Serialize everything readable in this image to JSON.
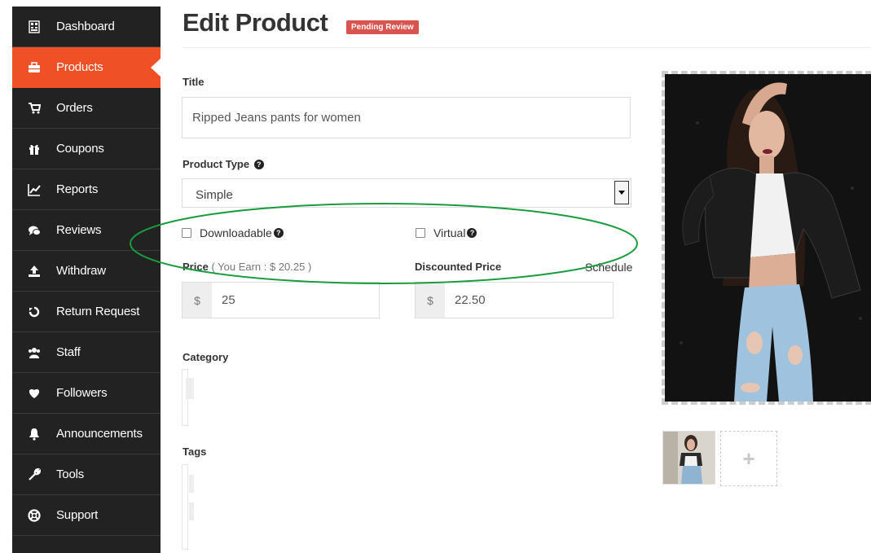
{
  "sidebar": {
    "items": [
      {
        "label": "Dashboard",
        "icon": "dashboard-icon"
      },
      {
        "label": "Products",
        "icon": "briefcase-icon",
        "active": true
      },
      {
        "label": "Orders",
        "icon": "cart-icon"
      },
      {
        "label": "Coupons",
        "icon": "gift-icon"
      },
      {
        "label": "Reports",
        "icon": "line-chart-icon"
      },
      {
        "label": "Reviews",
        "icon": "comments-icon"
      },
      {
        "label": "Withdraw",
        "icon": "upload-icon"
      },
      {
        "label": "Return Request",
        "icon": "undo-icon"
      },
      {
        "label": "Staff",
        "icon": "users-icon"
      },
      {
        "label": "Followers",
        "icon": "heart-icon"
      },
      {
        "label": "Announcements",
        "icon": "bell-icon"
      },
      {
        "label": "Tools",
        "icon": "wrench-icon"
      },
      {
        "label": "Support",
        "icon": "life-ring-icon"
      }
    ],
    "accent_color": "#f05025",
    "background": "#222222"
  },
  "header": {
    "title": "Edit Product",
    "status_badge": "Pending Review",
    "badge_color": "#d9534f"
  },
  "form": {
    "title_label": "Title",
    "title_value": "Ripped Jeans pants for women",
    "product_type_label": "Product Type",
    "product_type_value": "Simple",
    "downloadable_label": "Downloadable",
    "virtual_label": "Virtual",
    "price_label": "Price",
    "price_earn_note": "( You Earn : $ 20.25 )",
    "currency_symbol": "$",
    "price_value": "25",
    "discounted_price_label": "Discounted Price",
    "discounted_price_value": "22.50",
    "schedule_link": "Schedule",
    "category_label": "Category",
    "tags_label": "Tags"
  },
  "images": {
    "featured_alt": "product-photo",
    "gallery_add_symbol": "+"
  },
  "annotation": {
    "highlight_color": "#1a9c3e"
  }
}
